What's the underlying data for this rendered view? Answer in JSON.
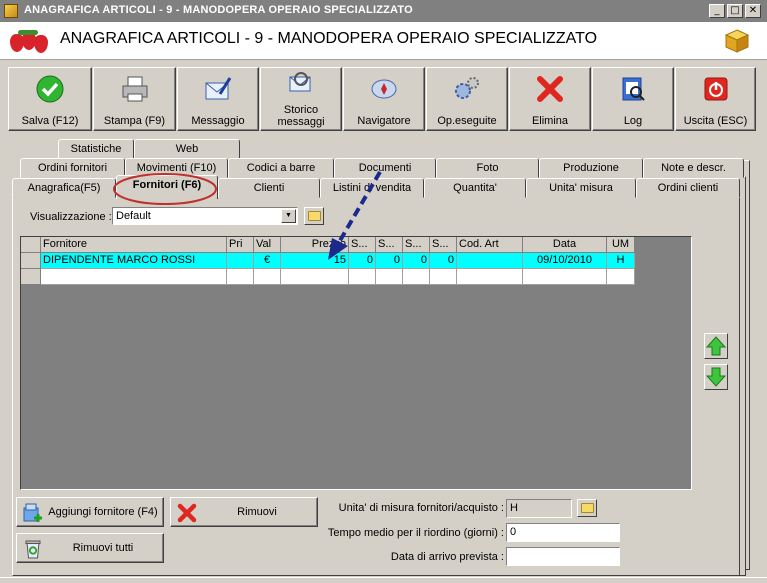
{
  "window": {
    "title": "ANAGRAFICA ARTICOLI - 9 - MANODOPERA OPERAIO SPECIALIZZATO",
    "minimize": "_",
    "maximize": "□",
    "close": "✕"
  },
  "header": {
    "title": "ANAGRAFICA ARTICOLI - 9 - MANODOPERA OPERAIO SPECIALIZZATO"
  },
  "toolbar": [
    {
      "label": "Salva (F12)",
      "icon": "check-icon"
    },
    {
      "label": "Stampa (F9)",
      "icon": "printer-icon"
    },
    {
      "label": "Messaggio",
      "icon": "mail-icon"
    },
    {
      "label_line1": "Storico",
      "label_line2": "messaggi",
      "icon": "mail-search-icon"
    },
    {
      "label": "Navigatore",
      "icon": "compass-icon"
    },
    {
      "label": "Op.eseguite",
      "icon": "gears-icon"
    },
    {
      "label": "Elimina",
      "icon": "delete-x-icon"
    },
    {
      "label": "Log",
      "icon": "log-icon"
    },
    {
      "label": "Uscita (ESC)",
      "icon": "exit-icon"
    }
  ],
  "tabs": {
    "row1": [
      "Statistiche",
      "Web"
    ],
    "row2": [
      "Ordini fornitori",
      "Movimenti (F10)",
      "Codici a barre",
      "Documenti",
      "Foto",
      "Produzione",
      "Note e descr."
    ],
    "row3": [
      "Anagrafica(F5)",
      "Fornitori (F6)",
      "Clienti",
      "Listini di vendita",
      "Quantita'",
      "Unita' misura",
      "Ordini clienti"
    ],
    "active": "Fornitori (F6)"
  },
  "view": {
    "label": "Visualizzazione :",
    "value": "Default"
  },
  "grid": {
    "columns": [
      "Fornitore",
      "Pri",
      "Val",
      "Prezzo",
      "S...",
      "S...",
      "S...",
      "S...",
      "Cod. Art",
      "Data",
      "UM"
    ],
    "rows": [
      [
        "DIPENDENTE MARCO ROSSI",
        "",
        "€",
        "15",
        "0",
        "0",
        "0",
        "0",
        "",
        "09/10/2010",
        "H"
      ]
    ]
  },
  "buttons": {
    "add_supplier": "Aggiungi fornitore (F4)",
    "remove": "Rimuovi",
    "remove_all": "Rimuovi tutti"
  },
  "form": {
    "um_label": "Unita' di misura fornitori/acquisto :",
    "um_value": "H",
    "lead_time_label": "Tempo medio per il riordino (giorni) :",
    "lead_time_value": "0",
    "arrival_label": "Data di arrivo prevista :",
    "arrival_value": ""
  },
  "colors": {
    "selected_row": "#00ffff",
    "annotation_arrow": "#1c2a8c",
    "annotation_circle": "#c0302c"
  }
}
